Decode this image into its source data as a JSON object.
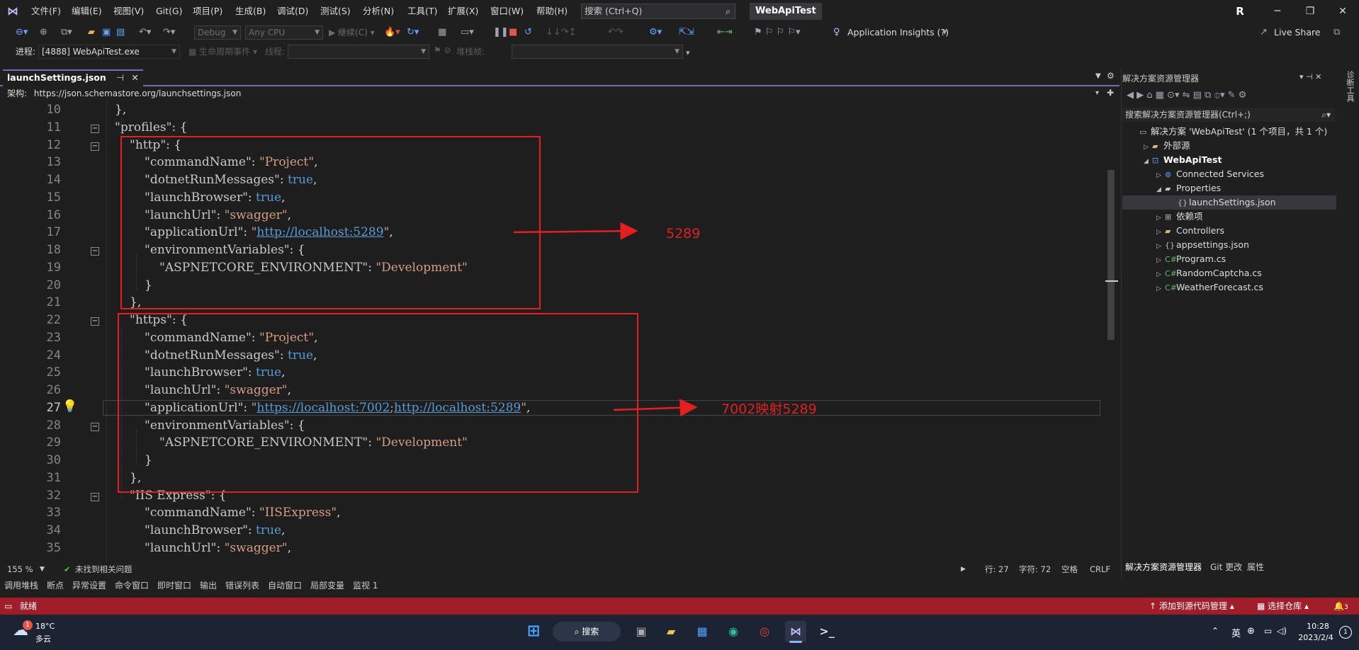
{
  "menu": [
    "文件(F)",
    "编辑(E)",
    "视图(V)",
    "Git(G)",
    "项目(P)",
    "生成(B)",
    "调试(D)",
    "测试(S)",
    "分析(N)",
    "工具(T)",
    "扩展(X)",
    "窗口(W)",
    "帮助(H)"
  ],
  "search": {
    "label": "搜索 (Ctrl+Q)"
  },
  "solution_name": "WebApiTest",
  "user_initial": "R",
  "toolbar": {
    "config": "Debug",
    "platform": "Any CPU",
    "continue_label": "继续(C)",
    "app_insights": "Application Insights (?)",
    "live_share": "Live Share"
  },
  "toolbar2": {
    "process_label": "进程:",
    "process_value": "[4888] WebApiTest.exe",
    "lifecycle": "生命周期事件",
    "thread": "线程:",
    "stackframe": "堆栈帧:"
  },
  "doc_tab": {
    "title": "launchSettings.json"
  },
  "schema": {
    "label": "架构:",
    "url": "https://json.schemastore.org/launchsettings.json"
  },
  "editor": {
    "current_line": "27",
    "lines": [
      {
        "n": "10",
        "parts": [
          [
            "p",
            "},"
          ]
        ],
        "indent": 1
      },
      {
        "n": "11",
        "parts": [
          [
            "k",
            "\"profiles\""
          ],
          [
            "p",
            ": {"
          ]
        ],
        "indent": 1
      },
      {
        "n": "12",
        "parts": [
          [
            "k",
            "\"http\""
          ],
          [
            "p",
            ": {"
          ]
        ],
        "indent": 2
      },
      {
        "n": "13",
        "parts": [
          [
            "k",
            "\"commandName\""
          ],
          [
            "p",
            ": "
          ],
          [
            "s",
            "\"Project\""
          ],
          [
            "p",
            ","
          ]
        ],
        "indent": 3
      },
      {
        "n": "14",
        "parts": [
          [
            "k",
            "\"dotnetRunMessages\""
          ],
          [
            "p",
            ": "
          ],
          [
            "b",
            "true"
          ],
          [
            "p",
            ","
          ]
        ],
        "indent": 3
      },
      {
        "n": "15",
        "parts": [
          [
            "k",
            "\"launchBrowser\""
          ],
          [
            "p",
            ": "
          ],
          [
            "b",
            "true"
          ],
          [
            "p",
            ","
          ]
        ],
        "indent": 3
      },
      {
        "n": "16",
        "parts": [
          [
            "k",
            "\"launchUrl\""
          ],
          [
            "p",
            ": "
          ],
          [
            "s",
            "\"swagger\""
          ],
          [
            "p",
            ","
          ]
        ],
        "indent": 3
      },
      {
        "n": "17",
        "parts": [
          [
            "k",
            "\"applicationUrl\""
          ],
          [
            "p",
            ": "
          ],
          [
            "s",
            "\""
          ],
          [
            "u",
            "http://localhost:5289"
          ],
          [
            "s",
            "\""
          ],
          [
            "p",
            ","
          ]
        ],
        "indent": 3
      },
      {
        "n": "18",
        "parts": [
          [
            "k",
            "\"environmentVariables\""
          ],
          [
            "p",
            ": {"
          ]
        ],
        "indent": 3
      },
      {
        "n": "19",
        "parts": [
          [
            "k",
            "\"ASPNETCORE_ENVIRONMENT\""
          ],
          [
            "p",
            ": "
          ],
          [
            "s",
            "\"Development\""
          ]
        ],
        "indent": 4
      },
      {
        "n": "20",
        "parts": [
          [
            "p",
            "}"
          ]
        ],
        "indent": 3
      },
      {
        "n": "21",
        "parts": [
          [
            "p",
            "},"
          ]
        ],
        "indent": 2
      },
      {
        "n": "22",
        "parts": [
          [
            "k",
            "\"https\""
          ],
          [
            "p",
            ": {"
          ]
        ],
        "indent": 2
      },
      {
        "n": "23",
        "parts": [
          [
            "k",
            "\"commandName\""
          ],
          [
            "p",
            ": "
          ],
          [
            "s",
            "\"Project\""
          ],
          [
            "p",
            ","
          ]
        ],
        "indent": 3
      },
      {
        "n": "24",
        "parts": [
          [
            "k",
            "\"dotnetRunMessages\""
          ],
          [
            "p",
            ": "
          ],
          [
            "b",
            "true"
          ],
          [
            "p",
            ","
          ]
        ],
        "indent": 3
      },
      {
        "n": "25",
        "parts": [
          [
            "k",
            "\"launchBrowser\""
          ],
          [
            "p",
            ": "
          ],
          [
            "b",
            "true"
          ],
          [
            "p",
            ","
          ]
        ],
        "indent": 3
      },
      {
        "n": "26",
        "parts": [
          [
            "k",
            "\"launchUrl\""
          ],
          [
            "p",
            ": "
          ],
          [
            "s",
            "\"swagger\""
          ],
          [
            "p",
            ","
          ]
        ],
        "indent": 3
      },
      {
        "n": "27",
        "parts": [
          [
            "k",
            "\"applicationUrl\""
          ],
          [
            "p",
            ": "
          ],
          [
            "s",
            "\""
          ],
          [
            "u",
            "https://localhost:7002"
          ],
          [
            "s",
            ";"
          ],
          [
            "u",
            "http://localhost:5289"
          ],
          [
            "s",
            "\""
          ],
          [
            "p",
            ","
          ]
        ],
        "indent": 3
      },
      {
        "n": "28",
        "parts": [
          [
            "k",
            "\"environmentVariables\""
          ],
          [
            "p",
            ": {"
          ]
        ],
        "indent": 3
      },
      {
        "n": "29",
        "parts": [
          [
            "k",
            "\"ASPNETCORE_ENVIRONMENT\""
          ],
          [
            "p",
            ": "
          ],
          [
            "s",
            "\"Development\""
          ]
        ],
        "indent": 4
      },
      {
        "n": "30",
        "parts": [
          [
            "p",
            "}"
          ]
        ],
        "indent": 3
      },
      {
        "n": "31",
        "parts": [
          [
            "p",
            "},"
          ]
        ],
        "indent": 2
      },
      {
        "n": "32",
        "parts": [
          [
            "k",
            "\"IIS Express\""
          ],
          [
            "p",
            ": {"
          ]
        ],
        "indent": 2
      },
      {
        "n": "33",
        "parts": [
          [
            "k",
            "\"commandName\""
          ],
          [
            "p",
            ": "
          ],
          [
            "s",
            "\"IISExpress\""
          ],
          [
            "p",
            ","
          ]
        ],
        "indent": 3
      },
      {
        "n": "34",
        "parts": [
          [
            "k",
            "\"launchBrowser\""
          ],
          [
            "p",
            ": "
          ],
          [
            "b",
            "true"
          ],
          [
            "p",
            ","
          ]
        ],
        "indent": 3
      },
      {
        "n": "35",
        "parts": [
          [
            "k",
            "\"launchUrl\""
          ],
          [
            "p",
            ": "
          ],
          [
            "s",
            "\"swagger\""
          ],
          [
            "p",
            ","
          ]
        ],
        "indent": 3
      }
    ]
  },
  "annotations": {
    "first": "5289",
    "second": "7002映射5289"
  },
  "editor_status": {
    "zoom": "155 %",
    "issues": "未找到相关问题",
    "line": "行: 27",
    "col": "字符: 72",
    "spaces": "空格",
    "eol": "CRLF"
  },
  "solution_explorer": {
    "title": "解决方案资源管理器",
    "search": "搜索解决方案资源管理器(Ctrl+;)",
    "items": [
      {
        "label": "解决方案 'WebApiTest' (1 个项目，共 1 个)",
        "level": 0,
        "arrow": "",
        "icon": "solution-icon"
      },
      {
        "label": "外部源",
        "level": 1,
        "arrow": "▷",
        "icon": "folder-icon"
      },
      {
        "label": "WebApiTest",
        "level": 1,
        "arrow": "◢",
        "icon": "project-icon",
        "bold": true
      },
      {
        "label": "Connected Services",
        "level": 2,
        "arrow": "▷",
        "icon": "connected-services-icon"
      },
      {
        "label": "Properties",
        "level": 2,
        "arrow": "◢",
        "icon": "properties-icon"
      },
      {
        "label": "launchSettings.json",
        "level": 3,
        "arrow": "",
        "icon": "json-file-icon",
        "selected": true
      },
      {
        "label": "依赖项",
        "level": 2,
        "arrow": "▷",
        "icon": "dependencies-icon"
      },
      {
        "label": "Controllers",
        "level": 2,
        "arrow": "▷",
        "icon": "folder-icon"
      },
      {
        "label": "appsettings.json",
        "level": 2,
        "arrow": "▷",
        "icon": "json-file-icon"
      },
      {
        "label": "Program.cs",
        "level": 2,
        "arrow": "▷",
        "icon": "csharp-file-icon"
      },
      {
        "label": "RandomCaptcha.cs",
        "level": 2,
        "arrow": "▷",
        "icon": "csharp-file-icon"
      },
      {
        "label": "WeatherForecast.cs",
        "level": 2,
        "arrow": "▷",
        "icon": "csharp-file-icon"
      }
    ],
    "tabs": [
      "解决方案资源管理器",
      "Git 更改",
      "属性"
    ]
  },
  "side_label": "诊断工具",
  "bottom_tabs": [
    "调用堆栈",
    "断点",
    "异常设置",
    "命令窗口",
    "即时窗口",
    "输出",
    "错误列表",
    "自动窗口",
    "局部变量",
    "监视 1"
  ],
  "statusbar": {
    "ready": "就绪",
    "source_control": "添加到源代码管理",
    "repo": "选择仓库",
    "notifications": "3"
  },
  "taskbar": {
    "weather_temp": "18°C",
    "weather_desc": "多云",
    "weather_badge": "1",
    "search": "搜索",
    "ime": "英",
    "time": "10:28",
    "date": "2023/2/4",
    "notif_count": "1"
  },
  "colors": {
    "accent": "#7b68b5",
    "statusbar": "#a01d2a",
    "annotation": "#e51f1f"
  }
}
